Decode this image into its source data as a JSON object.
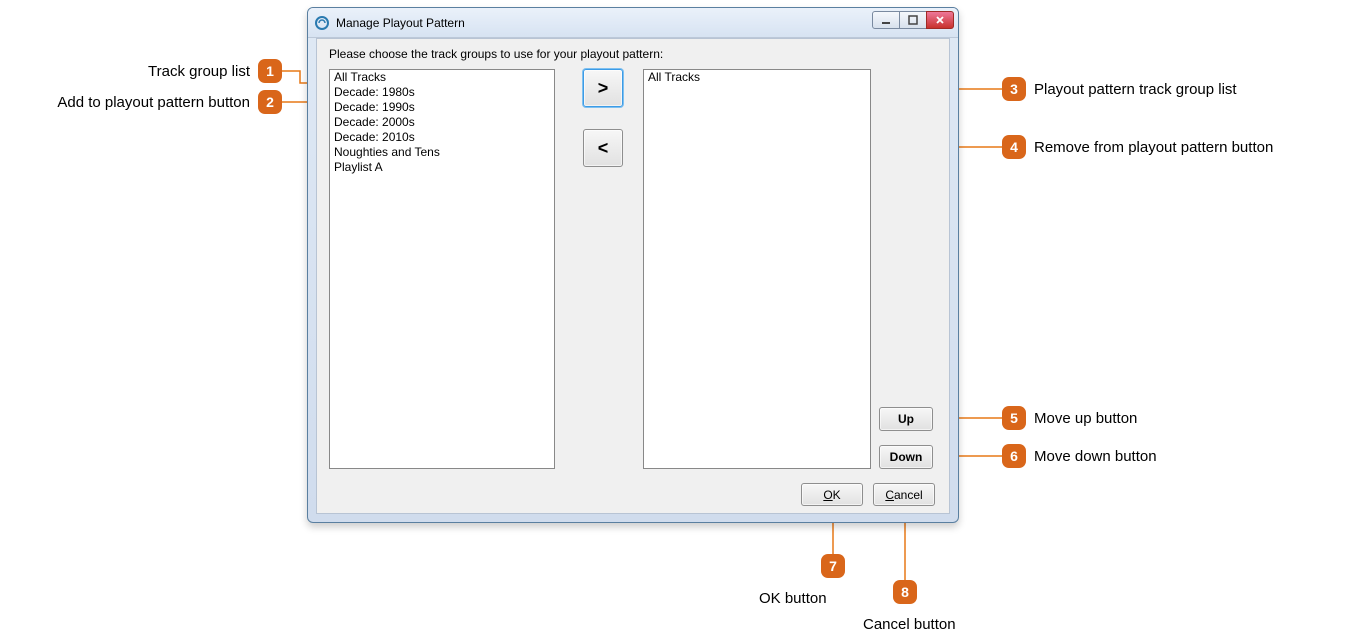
{
  "window": {
    "title": "Manage Playout Pattern",
    "instruction": "Please choose the track groups to use for your playout pattern:"
  },
  "left_list": {
    "items": [
      "All Tracks",
      "Decade: 1980s",
      "Decade: 1990s",
      "Decade: 2000s",
      "Decade: 2010s",
      "Noughties and Tens",
      "Playlist A"
    ]
  },
  "right_list": {
    "items": [
      "All Tracks"
    ]
  },
  "buttons": {
    "add": ">",
    "remove": "<",
    "up": "Up",
    "down": "Down",
    "ok": "OK",
    "cancel": "Cancel"
  },
  "callouts": {
    "c1": {
      "num": "1",
      "text": "Track group list"
    },
    "c2": {
      "num": "2",
      "text": "Add to playout pattern button"
    },
    "c3": {
      "num": "3",
      "text": "Playout pattern track group list"
    },
    "c4": {
      "num": "4",
      "text": "Remove from playout pattern button"
    },
    "c5": {
      "num": "5",
      "text": "Move up button"
    },
    "c6": {
      "num": "6",
      "text": "Move down button"
    },
    "c7": {
      "num": "7",
      "text": "OK button"
    },
    "c8": {
      "num": "8",
      "text": "Cancel button"
    }
  }
}
